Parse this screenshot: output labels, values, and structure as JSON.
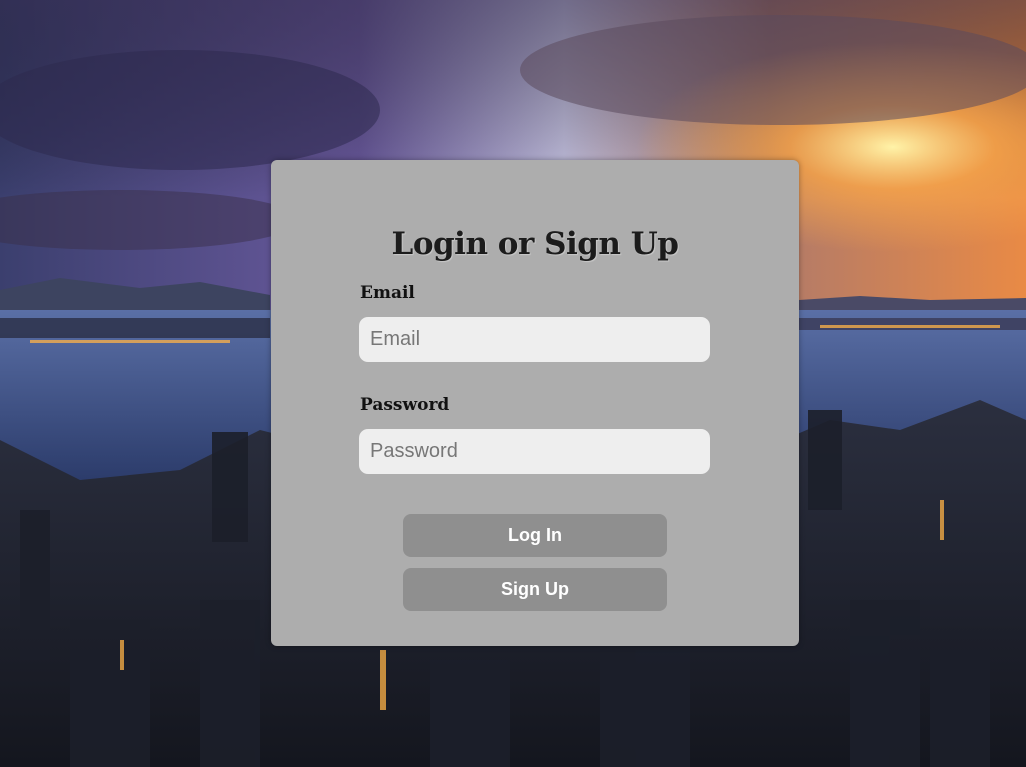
{
  "form": {
    "title": "Login or Sign Up",
    "email_label": "Email",
    "email_placeholder": "Email",
    "email_value": "",
    "password_label": "Password",
    "password_placeholder": "Password",
    "password_value": "",
    "login_label": "Log In",
    "signup_label": "Sign Up"
  },
  "colors": {
    "card_background": "#adadad",
    "input_background": "#eeeeee",
    "button_background": "#8f8f8f",
    "button_text": "#ffffff"
  }
}
